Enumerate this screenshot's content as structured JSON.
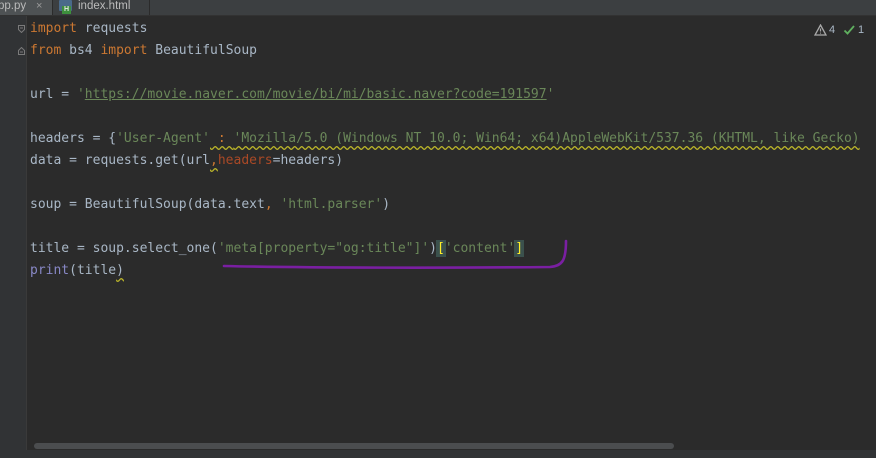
{
  "tabs": [
    {
      "label": "pp.py",
      "active": true
    },
    {
      "label": "index.html",
      "active": false
    }
  ],
  "inspections": {
    "warnings": "4",
    "weak_warnings": "1"
  },
  "code": {
    "l1_import": "import",
    "l1_module": " requests",
    "l2_from": "from",
    "l2_module": " bs4 ",
    "l2_import": "import",
    "l2_name": " BeautifulSoup",
    "l4_var": "url = ",
    "l4_q1": "'",
    "l4_url": "https://movie.naver.com/movie/bi/mi/basic.naver?code=191597",
    "l4_q2": "'",
    "l6_pre": "headers = {",
    "l6_key": "'User-Agent'",
    "l6_colon": " : ",
    "l6_val": "'Mozilla/5.0 (Windows NT 10.0; Win64; x64)AppleWebKit/537.36 (KHTML, like Gecko)",
    "l7_pre": "data = requests.get(url",
    "l7_comma": ",",
    "l7_param": "headers",
    "l7_post": "=headers)",
    "l9_pre": "soup = BeautifulSoup(data.text",
    "l9_comma": ", ",
    "l9_str": "'html.parser'",
    "l9_post": ")",
    "l11_pre": "title = soup.select_one(",
    "l11_str": "'meta[property=\"og:title\"]'",
    "l11_close": ")",
    "l11_lb": "[",
    "l11_key": "'content'",
    "l11_rb": "]",
    "l12_fn": "print",
    "l12_args": "(title",
    "l12_close": ")"
  },
  "colors": {
    "background": "#2b2b2b",
    "keyword": "#cc7832",
    "string": "#6a8759",
    "default_text": "#a9b7c6",
    "parameter": "#aa4926",
    "builtin": "#8888c6",
    "annotation_stroke": "#7a1fa2"
  }
}
